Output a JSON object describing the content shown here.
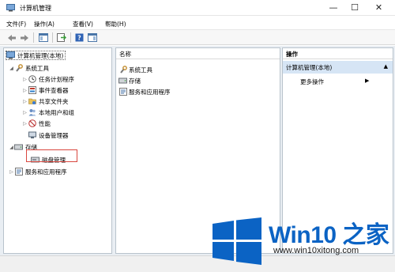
{
  "window": {
    "title": "计算机管理",
    "minimize": "—",
    "maximize": "☐",
    "close": "✕"
  },
  "menu": [
    "文件(F)",
    "操作(A)",
    "查看(V)",
    "帮助(H)"
  ],
  "tree": {
    "root": "计算机管理(本地)",
    "system_tools": "系统工具",
    "task_scheduler": "任务计划程序",
    "event_viewer": "事件查看器",
    "shared_folders": "共享文件夹",
    "local_users": "本地用户和组",
    "performance": "性能",
    "device_manager": "设备管理器",
    "storage": "存储",
    "disk_management": "磁盘管理",
    "services_apps": "服务和应用程序"
  },
  "list": {
    "column_name": "名称",
    "items": [
      "系统工具",
      "存储",
      "服务和应用程序"
    ]
  },
  "actions": {
    "header": "操作",
    "section": "计算机管理(本地)",
    "more": "更多操作"
  },
  "watermark": {
    "brand": "Win10 之家",
    "url": "www.win10xitong.com"
  },
  "colors": {
    "accent": "#0b63c4",
    "highlight_box": "#d9473f",
    "action_section": "#d6e5f5"
  }
}
